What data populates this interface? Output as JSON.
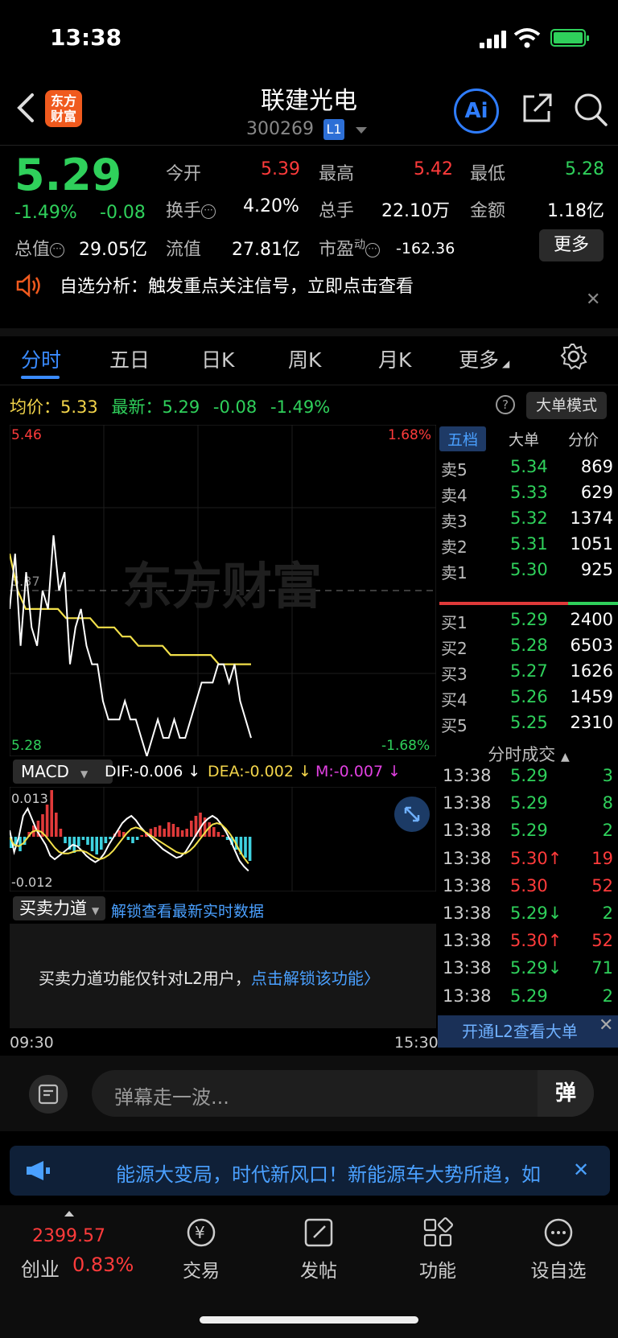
{
  "status": {
    "time": "13:38"
  },
  "header": {
    "logo_line1": "东方",
    "logo_line2": "财富",
    "name": "联建光电",
    "code": "300269",
    "level_badge": "L1",
    "ai_label": "Ai"
  },
  "quote": {
    "price": "5.29",
    "change_pct": "-1.49%",
    "change_abs": "-0.08",
    "open_label": "今开",
    "open": "5.39",
    "high_label": "最高",
    "high": "5.42",
    "low_label": "最低",
    "low": "5.28",
    "turnover_label": "换手",
    "turnover": "4.20%",
    "volume_label": "总手",
    "volume": "22.10万",
    "amount_label": "金额",
    "amount": "1.18亿",
    "mcap_label": "总值",
    "mcap": "29.05亿",
    "float_label": "流值",
    "float": "27.81亿",
    "pe_label": "市盈",
    "pe_sup": "动",
    "pe": "-162.36",
    "more_label": "更多"
  },
  "alert": {
    "text": "自选分析：触发重点关注信号，立即点击查看"
  },
  "tabs": [
    "分时",
    "五日",
    "日K",
    "周K",
    "月K",
    "更多"
  ],
  "avg_row": {
    "avg_label": "均价：",
    "avg": "5.33",
    "latest_label": "最新：",
    "latest": "5.29",
    "chg": "-0.08",
    "pct": "-1.49%",
    "mode_btn": "大单模式"
  },
  "chart": {
    "top_price": "5.46",
    "bottom_price": "5.28",
    "top_pct": "1.68%",
    "bottom_pct": "-1.68%",
    "mid_price": "5.37",
    "watermark": "东方财富"
  },
  "chart_data": {
    "type": "line",
    "series": [
      {
        "values": [
          5.36,
          5.39,
          5.34,
          5.38,
          5.35,
          5.34,
          5.37,
          5.36,
          5.4,
          5.37,
          5.38,
          5.33,
          5.35,
          5.36,
          5.34,
          5.33,
          5.33,
          5.31,
          5.3,
          5.3,
          5.3,
          5.31,
          5.3,
          5.3,
          5.29,
          5.28,
          5.29,
          5.3,
          5.29,
          5.29,
          5.3,
          5.29,
          5.29,
          5.3,
          5.31,
          5.32,
          5.32,
          5.32,
          5.33,
          5.33,
          5.32,
          5.33,
          5.31,
          5.3,
          5.29
        ]
      },
      {
        "values": [
          5.39,
          5.37,
          5.36,
          5.36,
          5.36,
          5.36,
          5.36,
          5.355,
          5.355,
          5.355,
          5.355,
          5.35,
          5.35,
          5.35,
          5.345,
          5.345,
          5.34,
          5.34,
          5.34,
          5.34,
          5.335,
          5.335,
          5.335,
          5.335,
          5.335,
          5.335,
          5.33,
          5.33,
          5.33,
          5.33,
          5.33
        ]
      }
    ],
    "ylim": [
      5.28,
      5.46
    ]
  },
  "macd": {
    "btn": "MACD",
    "dif": "DIF:-0.006 ↓",
    "dea": "DEA:-0.002 ↓",
    "m": "M:-0.007 ↓",
    "top": "0.013",
    "bottom": "-0.012"
  },
  "bml": {
    "btn": "买卖力道",
    "unlock": "解锁查看最新实时数据",
    "msg": "买卖力道功能仅针对L2用户，",
    "msg_link": "点击解锁该功能"
  },
  "times": {
    "start": "09:30",
    "end": "15:30"
  },
  "orderbook": {
    "tabs": [
      "五档",
      "大单",
      "分价"
    ],
    "asks": [
      {
        "label": "卖5",
        "price": "5.34",
        "vol": "869"
      },
      {
        "label": "卖4",
        "price": "5.33",
        "vol": "629"
      },
      {
        "label": "卖3",
        "price": "5.32",
        "vol": "1374"
      },
      {
        "label": "卖2",
        "price": "5.31",
        "vol": "1051"
      },
      {
        "label": "卖1",
        "price": "5.30",
        "vol": "925"
      }
    ],
    "bids": [
      {
        "label": "买1",
        "price": "5.29",
        "vol": "2400"
      },
      {
        "label": "买2",
        "price": "5.28",
        "vol": "6503"
      },
      {
        "label": "买3",
        "price": "5.27",
        "vol": "1626"
      },
      {
        "label": "买4",
        "price": "5.26",
        "vol": "1459"
      },
      {
        "label": "买5",
        "price": "5.25",
        "vol": "2310"
      }
    ],
    "trades_title": "分时成交",
    "trades": [
      {
        "t": "13:38",
        "p": "5.29",
        "v": "3"
      },
      {
        "t": "13:38",
        "p": "5.29",
        "v": "8"
      },
      {
        "t": "13:38",
        "p": "5.29",
        "v": "2"
      },
      {
        "t": "13:38",
        "p": "5.30↑",
        "v": "19"
      },
      {
        "t": "13:38",
        "p": "5.30",
        "v": "52"
      },
      {
        "t": "13:38",
        "p": "5.29↓",
        "v": "2"
      },
      {
        "t": "13:38",
        "p": "5.30↑",
        "v": "52"
      },
      {
        "t": "13:38",
        "p": "5.29↓",
        "v": "71"
      },
      {
        "t": "13:38",
        "p": "5.29",
        "v": "2"
      }
    ],
    "l2_banner": "开通L2查看大单"
  },
  "danmu": {
    "placeholder": "弹幕走一波...",
    "send": "弹"
  },
  "ad": {
    "text": "能源大变局，时代新风口！新能源车大势所趋，如"
  },
  "index": {
    "value": "2399.57",
    "name": "创业",
    "pct": "0.83%"
  },
  "nav": [
    "交易",
    "发帖",
    "功能",
    "设自选"
  ]
}
